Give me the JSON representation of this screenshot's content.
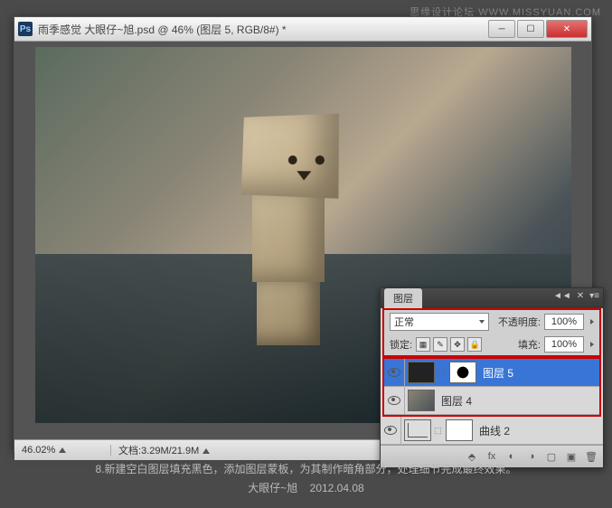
{
  "watermark": "思缘设计论坛 WWW.MISSYUAN.COM",
  "window": {
    "title": "雨季感觉  大眼仔~旭.psd @ 46% (图层 5, RGB/8#) *"
  },
  "statusbar": {
    "zoom": "46.02%",
    "doc_label": "文档:",
    "doc_value": "3.29M/21.9M"
  },
  "layers_panel": {
    "tab": "图层",
    "blend_mode": "正常",
    "opacity_label": "不透明度:",
    "opacity_value": "100%",
    "lock_label": "锁定:",
    "fill_label": "填充:",
    "fill_value": "100%",
    "layers": [
      {
        "name": "图层 5"
      },
      {
        "name": "图层 4"
      },
      {
        "name": "曲线 2"
      }
    ]
  },
  "caption": {
    "line1": "8.新建空白图层填充黑色，添加图层蒙板，为其制作暗角部分，处理细节完成最终效果。",
    "line2_author": "大眼仔~旭",
    "line2_date": "2012.04.08"
  }
}
